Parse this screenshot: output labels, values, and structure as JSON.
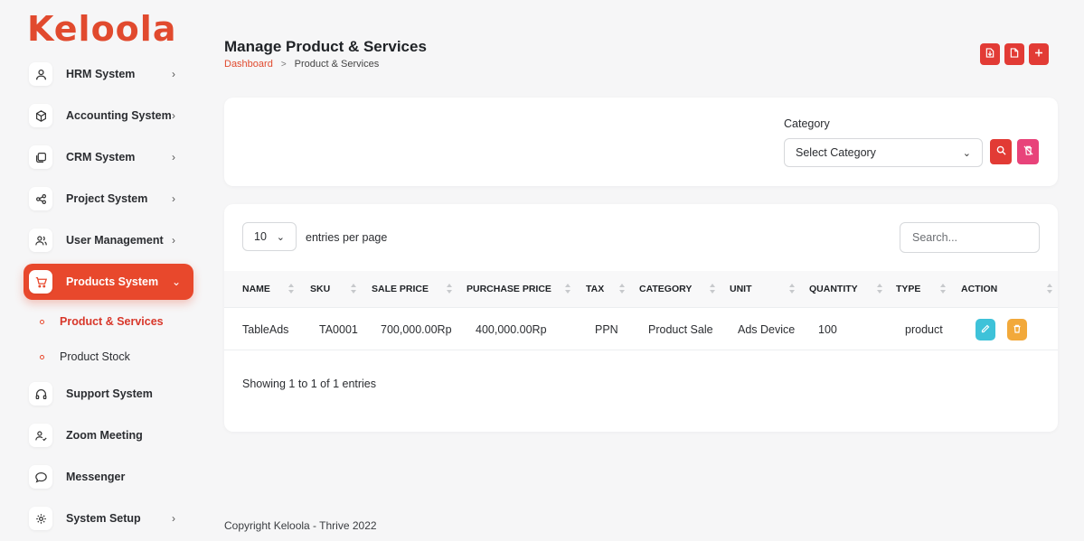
{
  "app": {
    "logo_text": "Keloola",
    "brand_color": "#e8482c"
  },
  "sidebar": {
    "items": [
      {
        "label": "HRM System",
        "icon": "user-icon",
        "chevron": "›"
      },
      {
        "label": "Accounting System",
        "icon": "box-icon",
        "chevron": "›"
      },
      {
        "label": "CRM System",
        "icon": "layers-icon",
        "chevron": "›"
      },
      {
        "label": "Project System",
        "icon": "share-icon",
        "chevron": "›"
      },
      {
        "label": "User Management",
        "icon": "users-icon",
        "chevron": "›"
      },
      {
        "label": "Products System",
        "icon": "cart-icon",
        "chevron": "⌄",
        "active": true
      },
      {
        "label": "Support System",
        "icon": "headphones-icon"
      },
      {
        "label": "Zoom Meeting",
        "icon": "user-check-icon"
      },
      {
        "label": "Messenger",
        "icon": "message-icon"
      },
      {
        "label": "System Setup",
        "icon": "settings-icon",
        "chevron": "›"
      }
    ],
    "sub_items": [
      {
        "label": "Product & Services",
        "current": true
      },
      {
        "label": "Product Stock"
      }
    ]
  },
  "header": {
    "title": "Manage Product & Services",
    "breadcrumb_home": "Dashboard",
    "breadcrumb_sep": ">",
    "breadcrumb_current": "Product & Services",
    "actions": [
      "import-icon",
      "export-icon",
      "plus-icon"
    ]
  },
  "filter": {
    "label": "Category",
    "select_value": "Select Category",
    "chevron": "⌄"
  },
  "table": {
    "entries_value": "10",
    "entries_chevron": "⌄",
    "entries_label": "entries per page",
    "search_placeholder": "Search...",
    "columns": [
      "NAME",
      "SKU",
      "SALE PRICE",
      "PURCHASE PRICE",
      "TAX",
      "CATEGORY",
      "UNIT",
      "QUANTITY",
      "TYPE",
      "ACTION"
    ],
    "rows": [
      {
        "name": "TableAds",
        "sku": "TA0001",
        "sale_price": "700,000.00Rp",
        "purchase_price": "400,000.00Rp",
        "tax": "PPN",
        "category": "Product Sale",
        "unit": "Ads Device",
        "quantity": "100",
        "type": "product"
      }
    ],
    "showing_text": "Showing 1 to 1 of 1 entries"
  },
  "footer": {
    "text": "Copyright Keloola - Thrive 2022"
  }
}
